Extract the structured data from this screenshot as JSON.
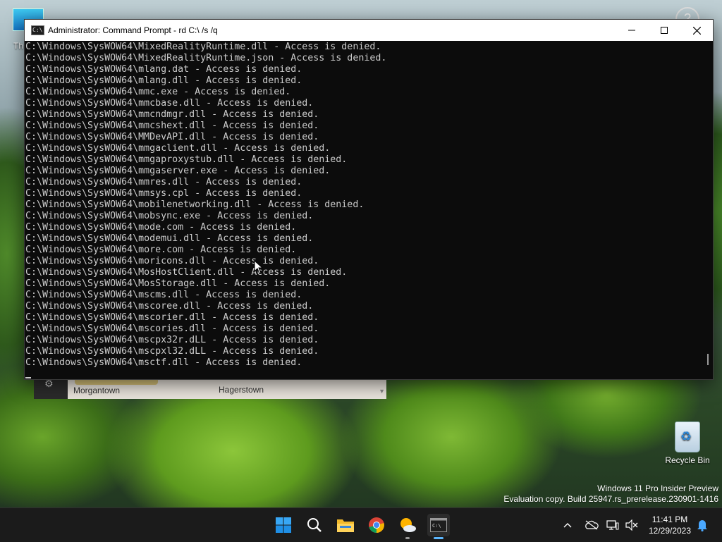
{
  "desktop": {
    "this_pc_label": "Th",
    "recycle_bin_label": "Recycle Bin",
    "watermark_line1": "Windows 11 Pro Insider Preview",
    "watermark_line2": "Evaluation copy. Build 25947.rs_prerelease.230901-1416",
    "background_widget": {
      "city_left": "Morgantown",
      "city_right": "Hagerstown"
    }
  },
  "cmd": {
    "title": "Administrator: Command Prompt - rd  C:\\ /s /q",
    "icon_text": "C:\\",
    "lines": [
      "C:\\Windows\\SysWOW64\\MixedRealityRuntime.dll - Access is denied.",
      "C:\\Windows\\SysWOW64\\MixedRealityRuntime.json - Access is denied.",
      "C:\\Windows\\SysWOW64\\mlang.dat - Access is denied.",
      "C:\\Windows\\SysWOW64\\mlang.dll - Access is denied.",
      "C:\\Windows\\SysWOW64\\mmc.exe - Access is denied.",
      "C:\\Windows\\SysWOW64\\mmcbase.dll - Access is denied.",
      "C:\\Windows\\SysWOW64\\mmcndmgr.dll - Access is denied.",
      "C:\\Windows\\SysWOW64\\mmcshext.dll - Access is denied.",
      "C:\\Windows\\SysWOW64\\MMDevAPI.dll - Access is denied.",
      "C:\\Windows\\SysWOW64\\mmgaclient.dll - Access is denied.",
      "C:\\Windows\\SysWOW64\\mmgaproxystub.dll - Access is denied.",
      "C:\\Windows\\SysWOW64\\mmgaserver.exe - Access is denied.",
      "C:\\Windows\\SysWOW64\\mmres.dll - Access is denied.",
      "C:\\Windows\\SysWOW64\\mmsys.cpl - Access is denied.",
      "C:\\Windows\\SysWOW64\\mobilenetworking.dll - Access is denied.",
      "C:\\Windows\\SysWOW64\\mobsync.exe - Access is denied.",
      "C:\\Windows\\SysWOW64\\mode.com - Access is denied.",
      "C:\\Windows\\SysWOW64\\modemui.dll - Access is denied.",
      "C:\\Windows\\SysWOW64\\more.com - Access is denied.",
      "C:\\Windows\\SysWOW64\\moricons.dll - Access is denied.",
      "C:\\Windows\\SysWOW64\\MosHostClient.dll - Access is denied.",
      "C:\\Windows\\SysWOW64\\MosStorage.dll - Access is denied.",
      "C:\\Windows\\SysWOW64\\mscms.dll - Access is denied.",
      "C:\\Windows\\SysWOW64\\mscoree.dll - Access is denied.",
      "C:\\Windows\\SysWOW64\\mscorier.dll - Access is denied.",
      "C:\\Windows\\SysWOW64\\mscories.dll - Access is denied.",
      "C:\\Windows\\SysWOW64\\mscpx32r.dLL - Access is denied.",
      "C:\\Windows\\SysWOW64\\mscpxl32.dLL - Access is denied.",
      "C:\\Windows\\SysWOW64\\msctf.dll - Access is denied."
    ]
  },
  "taskbar": {
    "items": [
      "start-icon",
      "search-icon",
      "file-explorer-icon",
      "chrome-icon",
      "weather-icon",
      "terminal-icon"
    ],
    "clock_time": "11:41 PM",
    "clock_date": "12/29/2023"
  },
  "colors": {
    "console_bg": "#0c0c0c",
    "console_text": "#cccccc",
    "taskbar_bg": "#1b1b1b",
    "accent": "#5cb7ff"
  }
}
